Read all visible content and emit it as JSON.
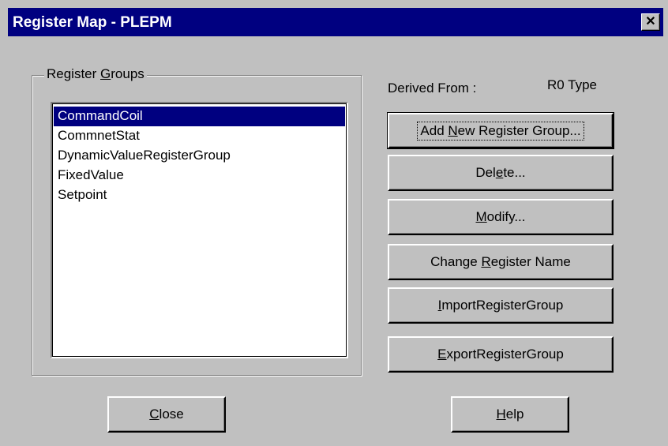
{
  "window": {
    "title": "Register Map - PLEPM",
    "close_glyph": "✕"
  },
  "groups": {
    "legend_pre": "Register ",
    "legend_mnemonic": "G",
    "legend_post": "roups",
    "items": [
      "CommandCoil",
      "CommnetStat",
      "DynamicValueRegisterGroup",
      "FixedValue",
      "Setpoint"
    ],
    "selected_index": 0
  },
  "derived": {
    "label": "Derived From :",
    "value": "R0 Type"
  },
  "buttons": {
    "add": {
      "pre": "Add ",
      "mn": "N",
      "post": "ew Register Group..."
    },
    "delete": {
      "pre": "Del",
      "mn": "e",
      "post": "te..."
    },
    "modify": {
      "pre": "",
      "mn": "M",
      "post": "odify..."
    },
    "change": {
      "pre": "Change ",
      "mn": "R",
      "post": "egister Name"
    },
    "import": {
      "pre": "",
      "mn": "I",
      "post": "mportRegisterGroup"
    },
    "export": {
      "pre": "",
      "mn": "E",
      "post": "xportRegisterGroup"
    },
    "close": {
      "pre": "",
      "mn": "C",
      "post": "lose"
    },
    "help": {
      "pre": "",
      "mn": "H",
      "post": "elp"
    }
  },
  "colors": {
    "titlebar": "#000080",
    "face": "#c0c0c0",
    "selection": "#000080"
  }
}
